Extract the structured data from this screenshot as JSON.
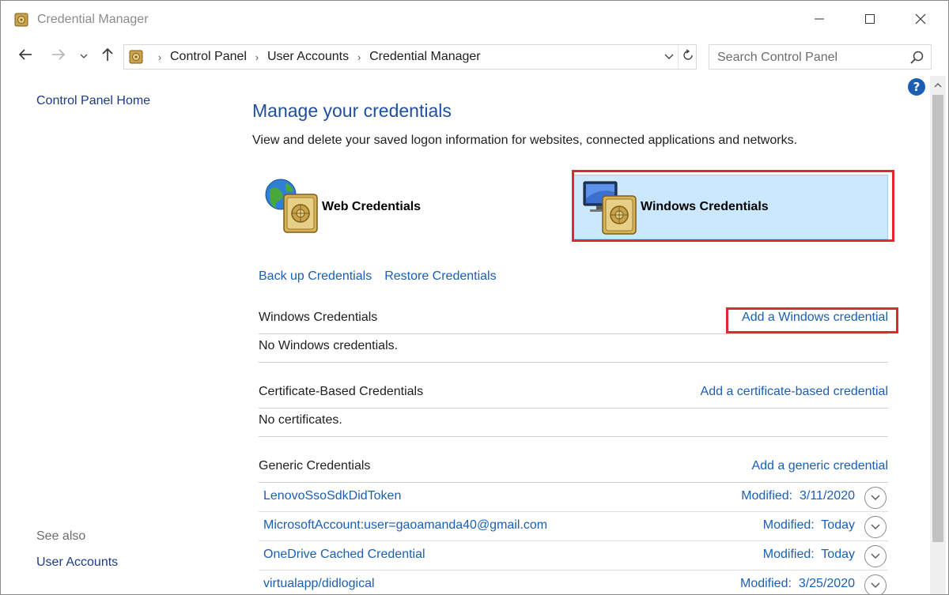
{
  "window": {
    "title": "Credential Manager"
  },
  "address": {
    "crumbs": [
      "Control Panel",
      "User Accounts",
      "Credential Manager"
    ]
  },
  "search": {
    "placeholder": "Search Control Panel"
  },
  "sidebar": {
    "home_label": "Control Panel Home",
    "see_also_label": "See also",
    "user_accounts_label": "User Accounts"
  },
  "main": {
    "heading": "Manage your credentials",
    "subheading": "View and delete your saved logon information for websites, connected applications and networks.",
    "tiles": {
      "web": "Web Credentials",
      "windows": "Windows Credentials"
    },
    "links": {
      "backup": "Back up Credentials",
      "restore": "Restore Credentials"
    },
    "sections": {
      "windows": {
        "title": "Windows Credentials",
        "action": "Add a Windows credential",
        "empty": "No Windows credentials."
      },
      "certificate": {
        "title": "Certificate-Based Credentials",
        "action": "Add a certificate-based credential",
        "empty": "No certificates."
      },
      "generic": {
        "title": "Generic Credentials",
        "action": "Add a generic credential",
        "items": [
          {
            "name": "LenovoSsoSdkDidToken",
            "modified": "Modified:  3/11/2020"
          },
          {
            "name": "MicrosoftAccount:user=gaoamanda40@gmail.com",
            "modified": "Modified:  Today"
          },
          {
            "name": "OneDrive Cached Credential",
            "modified": "Modified:  Today"
          },
          {
            "name": "virtualapp/didlogical",
            "modified": "Modified:  3/25/2020"
          }
        ]
      }
    }
  },
  "colors": {
    "link": "#1a5fb4",
    "heading": "#1e4fa0",
    "selected_tile": "#cce8ff",
    "highlight": "#e3272f"
  },
  "icons": {
    "app": "vault-icon",
    "back": "arrow-left-icon",
    "forward": "arrow-right-icon",
    "up": "arrow-up-icon",
    "refresh": "refresh-icon",
    "search": "search-icon",
    "help": "help-icon",
    "web_tile": "globe-vault-icon",
    "windows_tile": "monitor-vault-icon",
    "expand": "chevron-down-icon"
  }
}
